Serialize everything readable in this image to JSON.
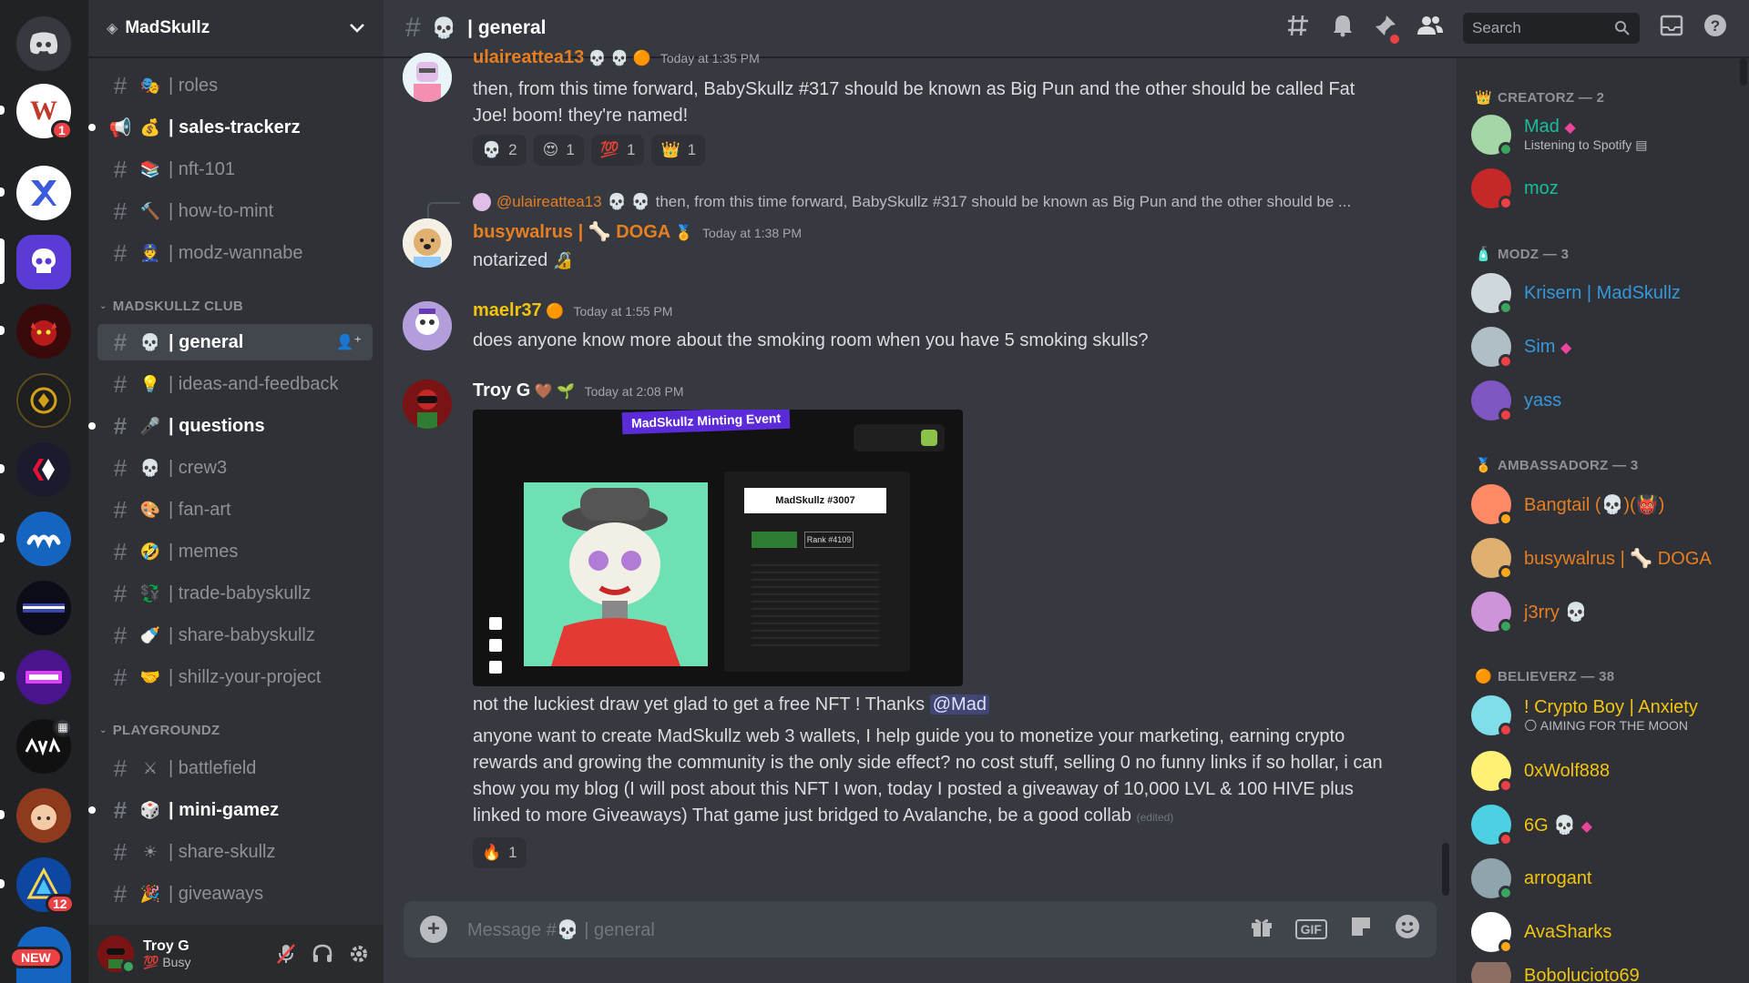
{
  "servers": {
    "new_badge": "NEW",
    "badge_world": "1",
    "badge_triangle": "12"
  },
  "sidebar": {
    "server_name": "MadSkullz",
    "channels_top": [
      {
        "emoji": "🎭",
        "name": "roles"
      },
      {
        "emoji": "💰",
        "name": "sales-trackerz"
      },
      {
        "emoji": "📚",
        "name": "nft-101"
      },
      {
        "emoji": "🔨",
        "name": "how-to-mint"
      },
      {
        "emoji": "👮",
        "name": "modz-wannabe"
      }
    ],
    "category_club": "MADSKULLZ CLUB",
    "channels_club": [
      {
        "emoji": "💀",
        "name": "general"
      },
      {
        "emoji": "💡",
        "name": "ideas-and-feedback"
      },
      {
        "emoji": "🎤",
        "name": "questions"
      },
      {
        "emoji": "💀",
        "name": "crew3"
      },
      {
        "emoji": "🎨",
        "name": "fan-art"
      },
      {
        "emoji": "🤣",
        "name": "memes"
      },
      {
        "emoji": "💱",
        "name": "trade-babyskullz"
      },
      {
        "emoji": "🍼",
        "name": "share-babyskullz"
      },
      {
        "emoji": "🤝",
        "name": "shillz-your-project"
      }
    ],
    "category_play": "PLAYGROUNDZ",
    "channels_play": [
      {
        "emoji": "⚔",
        "name": "battlefield"
      },
      {
        "emoji": "🎲",
        "name": "mini-gamez"
      },
      {
        "emoji": "☀",
        "name": "share-skullz"
      },
      {
        "emoji": "🎉",
        "name": "giveaways"
      }
    ]
  },
  "user": {
    "name": "Troy G",
    "status_emoji": "💯",
    "status_text": "Busy"
  },
  "topbar": {
    "channel": "general",
    "search_placeholder": "Search"
  },
  "messages": {
    "m1": {
      "author": "ulaireattea13",
      "timestamp": "Today at 1:35 PM",
      "text": "then, from this time forward, BabySkullz #317 should be known as Big Pun and the other should be called Fat Joe! boom! they're named!",
      "reactions": [
        {
          "emoji": "💀",
          "count": "2"
        },
        {
          "emoji": "😍",
          "count": "1"
        },
        {
          "emoji": "💯",
          "count": "1"
        },
        {
          "emoji": "👑",
          "count": "1"
        }
      ]
    },
    "m2": {
      "reply_author": "@ulaireattea13",
      "reply_text": "then, from this time forward, BabySkullz #317 should be known as Big Pun and the other should be ...",
      "author": "busywalrus | 🦴 DOGA",
      "timestamp": "Today at 1:38 PM",
      "text": "notarized"
    },
    "m3": {
      "author": "maelr37",
      "timestamp": "Today at 1:55 PM",
      "text": "does anyone know more about the smoking room when you have 5 smoking skulls?"
    },
    "m4": {
      "author": "Troy G",
      "timestamp": "Today at 2:08 PM",
      "image_banner": "MadSkullz Minting Event",
      "image_card_title": "MadSkullz #3007",
      "image_rank": "Rank #4109",
      "text1": "not the luckiest draw yet glad to get a free NFT ! Thanks",
      "mention": "@Mad",
      "text2": "anyone want to create MadSkullz web 3 wallets, I help guide you to monetize your marketing, earning crypto rewards and growing the community is the only side effect?  no cost stuff, selling 0 no funny links if so hollar, i can show you my blog (I will post about this NFT I won, today I posted a giveaway of 10,000 LVL & 100 HIVE plus linked to more Giveaways)  That game just bridged to Avalanche, be a good collab",
      "edited": "(edited)",
      "reaction_emoji": "🔥",
      "reaction_count": "1"
    }
  },
  "composer": {
    "placeholder": "Message #💀 | general"
  },
  "members": {
    "creatorz": "CREATORZ — 2",
    "modz": "MODZ — 3",
    "ambassadorz": "AMBASSADORZ — 3",
    "believerz": "BELIEVERZ — 38",
    "list": [
      {
        "name": "Mad",
        "sub": "Listening to Spotify",
        "color": "#1abc9c"
      },
      {
        "name": "moz",
        "sub": "",
        "color": "#1abc9c"
      },
      {
        "name": "Krisern | MadSkullz",
        "sub": "",
        "color": "#3498db"
      },
      {
        "name": "Sim",
        "sub": "",
        "color": "#3498db"
      },
      {
        "name": "yass",
        "sub": "",
        "color": "#3498db"
      },
      {
        "name": "Bangtail (💀)(👹)",
        "sub": "",
        "color": "#e67e22"
      },
      {
        "name": "busywalrus | 🦴 DOGA",
        "sub": "",
        "color": "#e67e22"
      },
      {
        "name": "j3rry 💀",
        "sub": "",
        "color": "#e67e22"
      },
      {
        "name": "! Crypto Boy | Anxiety",
        "sub": "AIMING FOR THE MOON",
        "color": "#f1c40f"
      },
      {
        "name": "0xWolf888",
        "sub": "",
        "color": "#f1c40f"
      },
      {
        "name": "6G 💀",
        "sub": "",
        "color": "#f1c40f"
      },
      {
        "name": "arrogant",
        "sub": "",
        "color": "#f1c40f"
      },
      {
        "name": "AvaSharks",
        "sub": "",
        "color": "#f1c40f"
      },
      {
        "name": "Bobolucioto69",
        "sub": "",
        "color": "#f1c40f"
      }
    ]
  },
  "colors": {
    "creator": "#1abc9c",
    "mod": "#3498db",
    "ambassador": "#e67e22",
    "believer": "#f1c40f",
    "online": "#3ba55d",
    "dnd": "#ed4245",
    "idle": "#faa81a"
  }
}
